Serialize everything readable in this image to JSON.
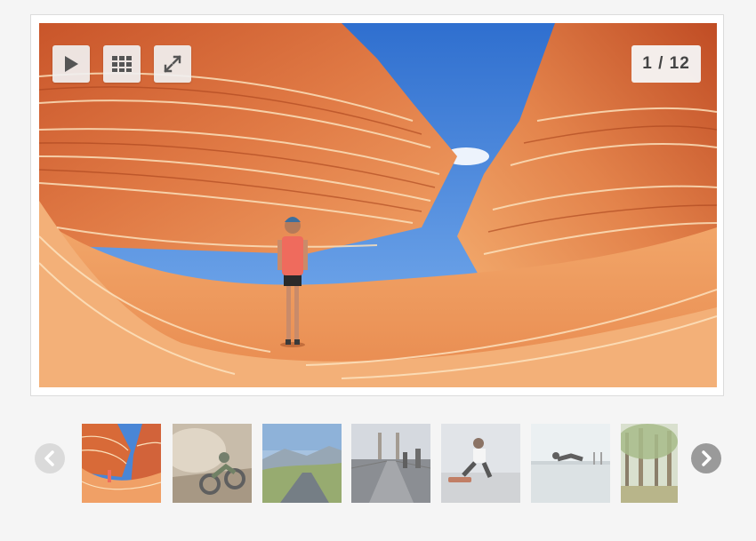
{
  "counter": "1 / 12",
  "controls": {
    "play": "play-icon",
    "grid": "grid-icon",
    "fullscreen": "expand-icon"
  },
  "nav": {
    "prev": "chevron-left-icon",
    "next": "chevron-right-icon"
  },
  "thumbnails": [
    {
      "subject": "sandstone-wave",
      "active": true
    },
    {
      "subject": "dirt-bike-rider",
      "active": false
    },
    {
      "subject": "mountain-road",
      "active": false
    },
    {
      "subject": "bridge-walkway",
      "active": false
    },
    {
      "subject": "skateboarder",
      "active": false
    },
    {
      "subject": "beach-jump",
      "active": false
    },
    {
      "subject": "forest",
      "active": false
    }
  ],
  "colors": {
    "background": "#f5f5f5",
    "frame": "#ffffff",
    "control_bg": "#f0f0f0",
    "icon": "#555555"
  }
}
